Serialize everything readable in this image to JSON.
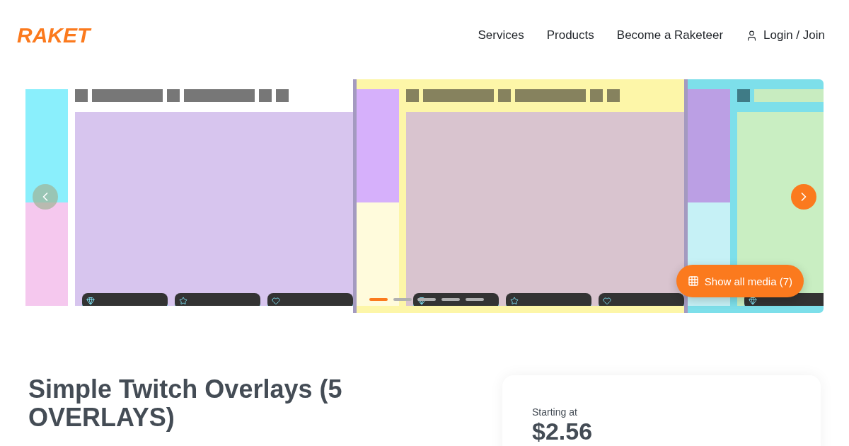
{
  "header": {
    "logo": "RAKET",
    "nav": [
      {
        "label": "Services",
        "kind": "link"
      },
      {
        "label": "Products",
        "kind": "link"
      },
      {
        "label": "Become a Raketeer",
        "kind": "link"
      },
      {
        "label": "Login / Join",
        "kind": "account"
      }
    ]
  },
  "gallery": {
    "prev_disabled": true,
    "dots": [
      {
        "selected": true
      },
      {
        "selected": false
      },
      {
        "selected": false
      },
      {
        "selected": false
      },
      {
        "selected": false
      }
    ],
    "show_all": "Show all media (7)"
  },
  "product": {
    "title": "Simple Twitch Overlays (5 OVERLAYS)"
  },
  "price_card": {
    "label": "Starting at",
    "price": "$2.56"
  }
}
